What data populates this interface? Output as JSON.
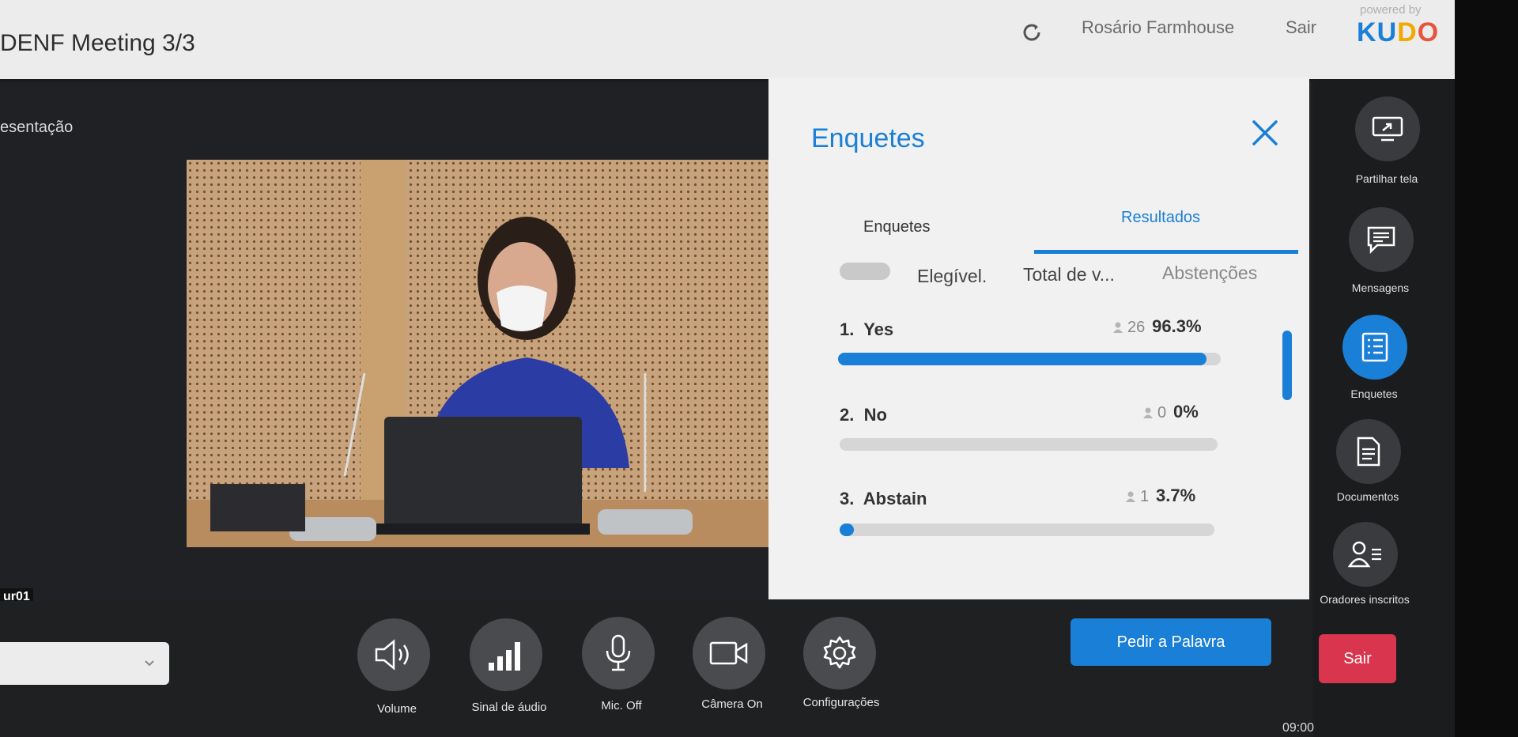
{
  "header": {
    "meeting_title": "DENF Meeting 3/3",
    "user_name": "Rosário Farmhouse",
    "exit_label": "Sair",
    "powered_by": "powered by",
    "logo_text": "KUDO"
  },
  "main": {
    "presentation_label": "esentação",
    "camera_label": "ur01"
  },
  "poll_panel": {
    "title": "Enquetes",
    "tabs": [
      {
        "label": "Enquetes",
        "active": false
      },
      {
        "label": "Resultados",
        "active": true
      }
    ],
    "stats": {
      "eligible": "Elegível.",
      "total": "Total de v...",
      "abstentions": "Abstenções"
    },
    "options": [
      {
        "number": "1.",
        "label": "Yes",
        "count": "26",
        "percent": "96.3%",
        "fraction": 0.963
      },
      {
        "number": "2.",
        "label": "No",
        "count": "0",
        "percent": "0%",
        "fraction": 0.0
      },
      {
        "number": "3.",
        "label": "Abstain",
        "count": "1",
        "percent": "3.7%",
        "fraction": 0.037
      }
    ]
  },
  "sidebar": {
    "items": [
      {
        "label": "Partilhar tela",
        "icon": "share-screen-icon",
        "active": false
      },
      {
        "label": "Mensagens",
        "icon": "chat-icon",
        "active": false
      },
      {
        "label": "Enquetes",
        "icon": "poll-icon",
        "active": true
      },
      {
        "label": "Documentos",
        "icon": "document-icon",
        "active": false
      },
      {
        "label": "Oradores inscritos",
        "icon": "speakers-icon",
        "active": false
      }
    ]
  },
  "controls": {
    "items": [
      {
        "label": "Volume",
        "icon": "speaker-icon"
      },
      {
        "label": "Sinal de áudio",
        "icon": "signal-icon"
      },
      {
        "label": "Mic. Off",
        "icon": "microphone-icon"
      },
      {
        "label": "Câmera On",
        "icon": "camera-icon"
      },
      {
        "label": "Configurações",
        "icon": "gear-icon"
      }
    ],
    "request_floor": "Pedir a Palavra",
    "leave": "Sair"
  },
  "taskbar": {
    "clock": "09:00"
  },
  "colors": {
    "accent": "#1a7fd6",
    "danger": "#d9354e"
  }
}
